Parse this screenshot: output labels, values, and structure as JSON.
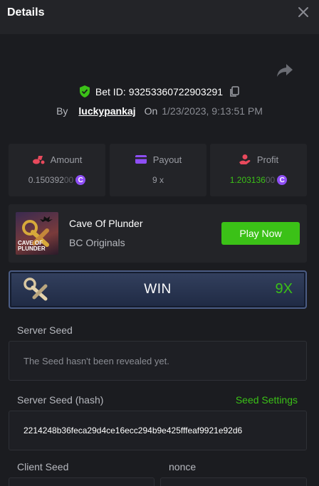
{
  "header": {
    "title": "Details",
    "close_icon": "close-icon"
  },
  "share_icon": "share-icon",
  "bet": {
    "id_label": "Bet ID:",
    "id": "93253360722903291",
    "by_label": "By",
    "user": "luckypankaj",
    "on_label": "On",
    "date": "1/23/2023, 9:13:51 PM"
  },
  "stats": {
    "amount": {
      "label": "Amount",
      "value_main": "0.150392",
      "value_dim": "00",
      "coin": "C",
      "icon": "amount-icon"
    },
    "payout": {
      "label": "Payout",
      "value": "9 x",
      "icon": "payout-card-icon"
    },
    "profit": {
      "label": "Profit",
      "value_main": "1.203136",
      "value_dim": "00",
      "coin": "C",
      "icon": "profit-icon"
    }
  },
  "game": {
    "name": "Cave Of Plunder",
    "provider": "BC Originals",
    "thumb_text_line1": "CAVE OF",
    "thumb_text_line2": "PLUNDER",
    "play_label": "Play Now"
  },
  "result": {
    "label": "WIN",
    "multiplier": "9X"
  },
  "seeds": {
    "server_seed_label": "Server Seed",
    "server_seed_value": "The Seed hasn't been revealed yet.",
    "server_hash_label": "Server Seed (hash)",
    "seed_settings_label": "Seed Settings",
    "server_hash_value": "2214248b36feca29d4ce16ecc294b9e425fffeaf9921e92d6",
    "client_seed_label": "Client Seed",
    "nonce_label": "nonce"
  },
  "colors": {
    "accent_green": "#3bc117",
    "coin_purple": "#8e4ef5",
    "background": "#1b1c20",
    "panel": "#232428"
  }
}
